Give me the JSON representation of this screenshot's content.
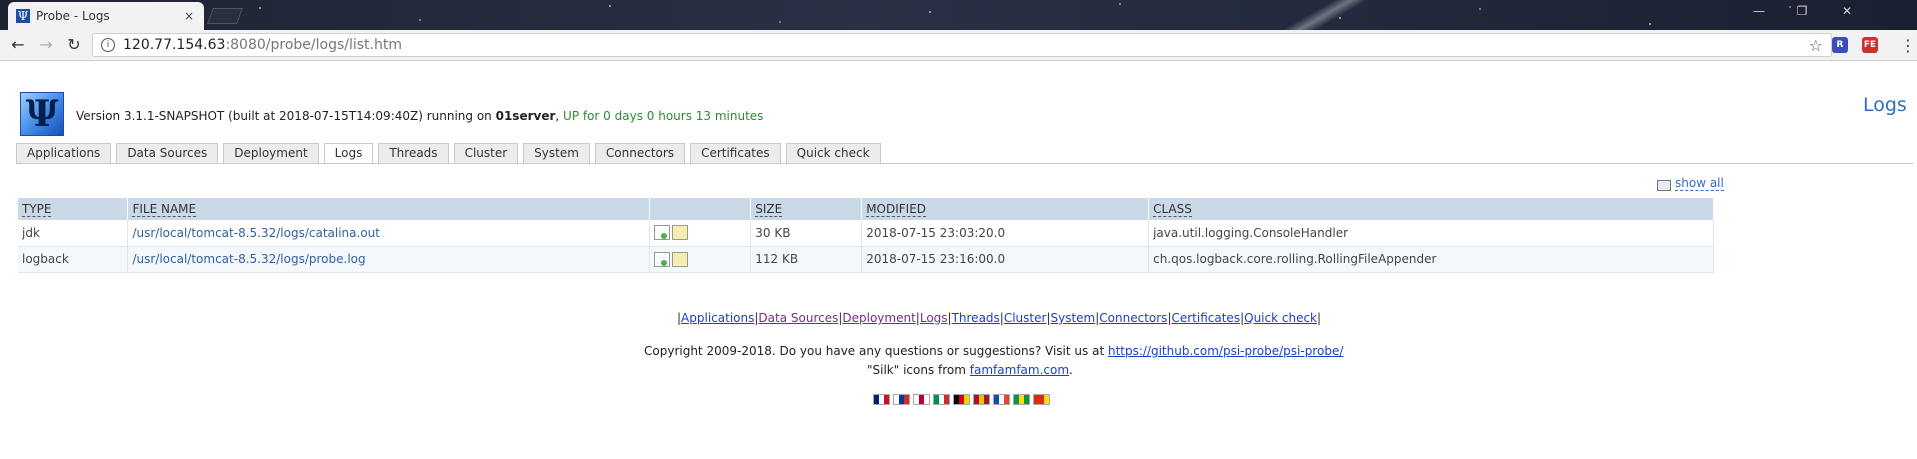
{
  "browser": {
    "tab_title": "Probe - Logs",
    "tab_close": "×",
    "favicon": "Ψ",
    "url_host": "120.77.154.63",
    "url_path": ":8080/probe/logs/list.htm",
    "omnibox_info": "i",
    "win_minimize": "—",
    "win_restore": "❐",
    "win_close": "✕",
    "ext1": "R",
    "ext2": "FE",
    "ext1_color": "#3b4cc0",
    "ext2_color": "#d32f2f"
  },
  "header": {
    "logo": "Ψ",
    "version_text": "Version 3.1.1-SNAPSHOT (built at 2018-07-15T14:09:40Z) running on ",
    "server_name": "01server",
    "comma": ", ",
    "uptime": "UP for 0 days 0 hours 13 minutes",
    "page_title": "Logs"
  },
  "nav_tabs": [
    {
      "label": "Applications"
    },
    {
      "label": "Data Sources"
    },
    {
      "label": "Deployment"
    },
    {
      "label": "Logs",
      "active": true
    },
    {
      "label": "Threads"
    },
    {
      "label": "Cluster"
    },
    {
      "label": "System"
    },
    {
      "label": "Connectors"
    },
    {
      "label": "Certificates"
    },
    {
      "label": "Quick check"
    }
  ],
  "show_all": "show all",
  "table": {
    "headers": [
      "TYPE",
      "FILE NAME",
      "",
      "SIZE",
      "MODIFIED",
      "CLASS"
    ],
    "rows": [
      {
        "type": "jdk",
        "file": "/usr/local/tomcat-8.5.32/logs/catalina.out",
        "size": "30 KB",
        "modified": "2018-07-15 23:03:20.0",
        "class": "java.util.logging.ConsoleHandler"
      },
      {
        "type": "logback",
        "file": "/usr/local/tomcat-8.5.32/logs/probe.log",
        "size": "112 KB",
        "modified": "2018-07-15 23:16:00.0",
        "class": "ch.qos.logback.core.rolling.RollingFileAppender"
      }
    ]
  },
  "footer": {
    "links": [
      "Applications",
      "Data Sources",
      "Deployment",
      "Logs",
      "Threads",
      "Cluster",
      "System",
      "Connectors",
      "Certificates",
      "Quick check"
    ],
    "separator": "|",
    "copyright_text": "Copyright 2009-2018. Do you have any questions or suggestions? Visit us at ",
    "copyright_link": "https://github.com/psi-probe/psi-probe/",
    "silk_prefix": "\"Silk\" icons from ",
    "silk_link": "famfamfam.com",
    "silk_suffix": "."
  },
  "flags": [
    {
      "name": "uk-flag",
      "colors": [
        "#012169",
        "#ffffff",
        "#c8102e"
      ]
    },
    {
      "name": "ru-flag",
      "colors": [
        "#ffffff",
        "#0039a6",
        "#d52b1e"
      ]
    },
    {
      "name": "jp-flag",
      "colors": [
        "#ffffff",
        "#bc002d",
        "#ffffff"
      ]
    },
    {
      "name": "it-flag",
      "colors": [
        "#009246",
        "#ffffff",
        "#ce2b37"
      ]
    },
    {
      "name": "de-flag",
      "colors": [
        "#000000",
        "#dd0000",
        "#ffce00"
      ]
    },
    {
      "name": "es-flag",
      "colors": [
        "#aa151b",
        "#f1bf00",
        "#aa151b"
      ]
    },
    {
      "name": "fr-flag",
      "colors": [
        "#0055a4",
        "#ffffff",
        "#ef4135"
      ]
    },
    {
      "name": "br-flag",
      "colors": [
        "#009c3b",
        "#ffdf00",
        "#009c3b"
      ]
    },
    {
      "name": "cn-flag",
      "colors": [
        "#de2910",
        "#de2910",
        "#ffde00"
      ]
    }
  ]
}
